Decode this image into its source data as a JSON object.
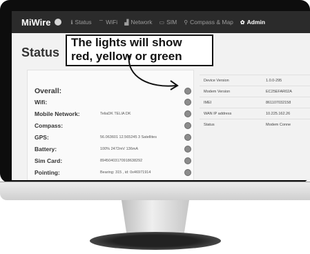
{
  "navbar": {
    "brand": "MiWire",
    "items": [
      {
        "label": "Status",
        "icon": "info-icon",
        "glyph": "ℹ",
        "active": false
      },
      {
        "label": "WiFi",
        "icon": "wifi-icon",
        "glyph": "⌔",
        "active": false
      },
      {
        "label": "Network",
        "icon": "signal-bars-icon",
        "glyph": "▟",
        "active": false
      },
      {
        "label": "SIM",
        "icon": "sim-card-icon",
        "glyph": "▭",
        "active": false
      },
      {
        "label": "Compass & Map",
        "icon": "map-pin-icon",
        "glyph": "⚲",
        "active": false
      },
      {
        "label": "Admin",
        "icon": "gear-icon",
        "glyph": "✿",
        "active": true
      }
    ]
  },
  "page": {
    "title": "Status"
  },
  "callout": {
    "line1": "The lights will show",
    "line2": "red, yellow or green"
  },
  "status_rows": [
    {
      "label": "Overall:",
      "value": ""
    },
    {
      "label": "Wifi:",
      "value": ""
    },
    {
      "label": "Mobile Network:",
      "value": "TeliaDK TELIA DK"
    },
    {
      "label": "Compass:",
      "value": ""
    },
    {
      "label": "GPS:",
      "value": "56.063601 12.565245 3 Satellites"
    },
    {
      "label": "Battery:",
      "value": "100% 2472mV 136mA"
    },
    {
      "label": "Sim Card:",
      "value": "89450403170918638292"
    },
    {
      "label": "Pointing:",
      "value": "Bearing: 315 , id: 0x46971914"
    }
  ],
  "device_info": [
    {
      "key": "Device Version",
      "value": "1.0.0-295"
    },
    {
      "key": "Modem Version",
      "value": "EC25EFAR02A"
    },
    {
      "key": "IMEI",
      "value": "861107032158"
    },
    {
      "key": "WAN IP address",
      "value": "10.225.162.26"
    },
    {
      "key": "Status",
      "value": "Modem Conne"
    }
  ],
  "colors": {
    "navbar": "#2b2b2b",
    "led": "#8c8c8c",
    "bezel": "#0d0d0d"
  }
}
